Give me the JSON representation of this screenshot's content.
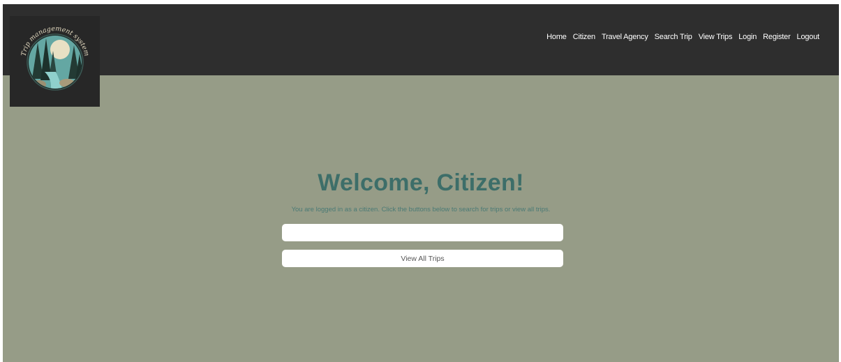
{
  "logo": {
    "arc_text": "Trip management system",
    "colors": {
      "bg": "#272727",
      "circle": "#64a7a3",
      "tree": "#233a34",
      "moon": "#e8e0c4",
      "rock": "#9b8f72"
    }
  },
  "nav": {
    "items": [
      "Home",
      "Citizen",
      "Travel Agency",
      "Search Trip",
      "View Trips",
      "Login",
      "Register",
      "Logout"
    ]
  },
  "main": {
    "title": "Welcome, Citizen!",
    "subtitle": "You are logged in as a citizen. Click the buttons below to search for trips or view all trips.",
    "search_button_label": "",
    "view_all_button_label": "View All Trips"
  },
  "colors": {
    "header_bg": "#2e2e2e",
    "page_bg": "#969c87",
    "title_color": "#3d6e69",
    "button_bg": "#ffffff"
  }
}
